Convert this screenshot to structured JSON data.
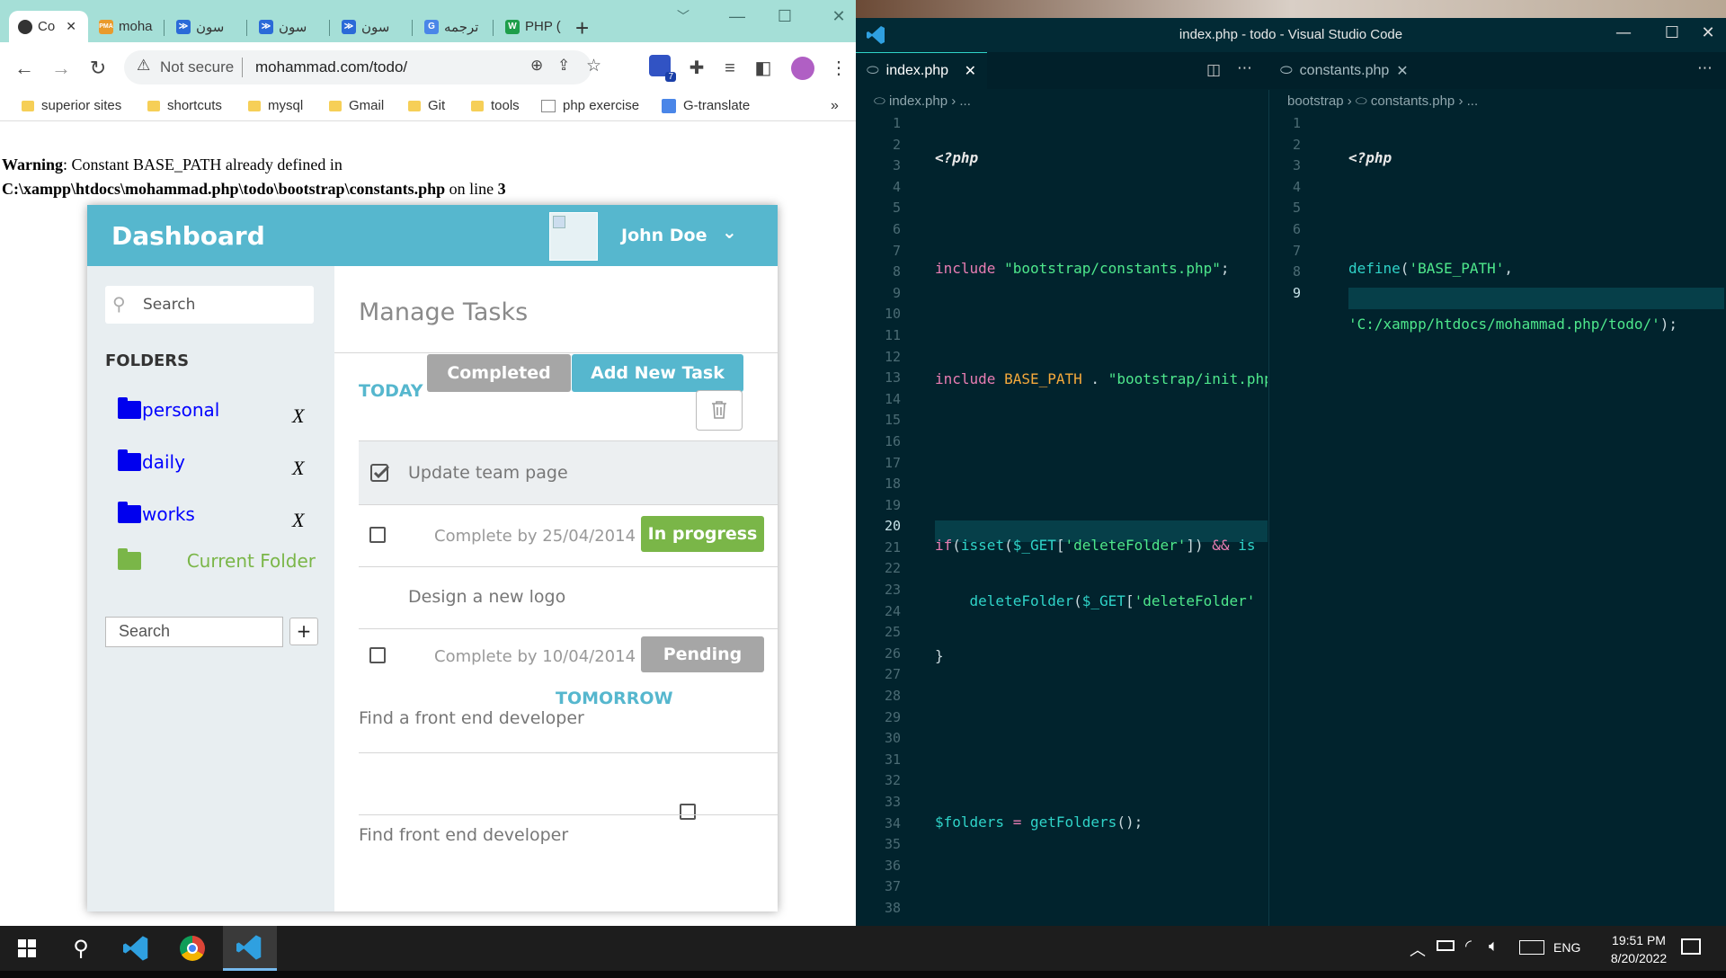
{
  "browser": {
    "tabs": [
      {
        "label": "Co",
        "active": true
      },
      {
        "label": "moha",
        "active": false
      },
      {
        "label": "سون",
        "active": false
      },
      {
        "label": "سون",
        "active": false
      },
      {
        "label": "سون",
        "active": false
      },
      {
        "label": "ترجمه",
        "active": false
      },
      {
        "label": "PHP (",
        "active": false
      }
    ],
    "new_tab": "+",
    "security": "Not secure",
    "url": "mohammad.com/todo/",
    "bookmarks": [
      "superior sites",
      "shortcuts",
      "mysql",
      "Gmail",
      "Git",
      "tools",
      "php exercise",
      "G-translate"
    ],
    "bookmarks_more": "»",
    "extension_badge": "7"
  },
  "page": {
    "warning_label": "Warning",
    "warning_text": ": Constant BASE_PATH already defined in",
    "warning_path": "C:\\xampp\\htdocs\\mohammad.php\\todo\\bootstrap\\constants.php",
    "warning_online": " on line ",
    "warning_line": "3",
    "dashboard": {
      "title": "Dashboard",
      "user": "John Doe",
      "search_placeholder": "Search",
      "folders_heading": "FOLDERS",
      "folders": [
        {
          "name": "personal",
          "delete": "X"
        },
        {
          "name": "daily",
          "delete": "X"
        },
        {
          "name": "works",
          "delete": "X"
        }
      ],
      "current_folder": "Current Folder",
      "new_folder_placeholder": "Search",
      "add_folder": "+",
      "main_title": "Manage Tasks",
      "today": "TODAY",
      "tomorrow": "TOMORROW",
      "btn_completed": "Completed",
      "btn_add": "Add New Task",
      "tasks": [
        {
          "title": "Update team page",
          "checked": true
        },
        {
          "due": "Complete by 25/04/2014",
          "badge": "In progress",
          "badge_color": "#7ab648"
        },
        {
          "title": "Design a new logo"
        },
        {
          "due": "Complete by 10/04/2014",
          "badge": "Pending",
          "badge_color": "#a6a6a6"
        },
        {
          "title": "Find a front end developer"
        },
        {
          "title": "Find front end developer"
        }
      ]
    }
  },
  "vscode": {
    "title": "index.php - todo - Visual Studio Code",
    "left_tab": "index.php",
    "right_tab": "constants.php",
    "left_crumb": [
      "index.php",
      "..."
    ],
    "right_crumb": [
      "bootstrap",
      "constants.php",
      "..."
    ],
    "left_line_count": 38,
    "right_line_count": 9,
    "left_active_line": 20,
    "right_active_line": 9
  },
  "taskbar": {
    "lang": "ENG",
    "time": "19:51 PM",
    "date": "8/20/2022"
  },
  "colors": {
    "accent": "#56b7ce",
    "success": "#7ab648",
    "muted": "#a6a6a6",
    "editor_bg": "#01232d"
  }
}
